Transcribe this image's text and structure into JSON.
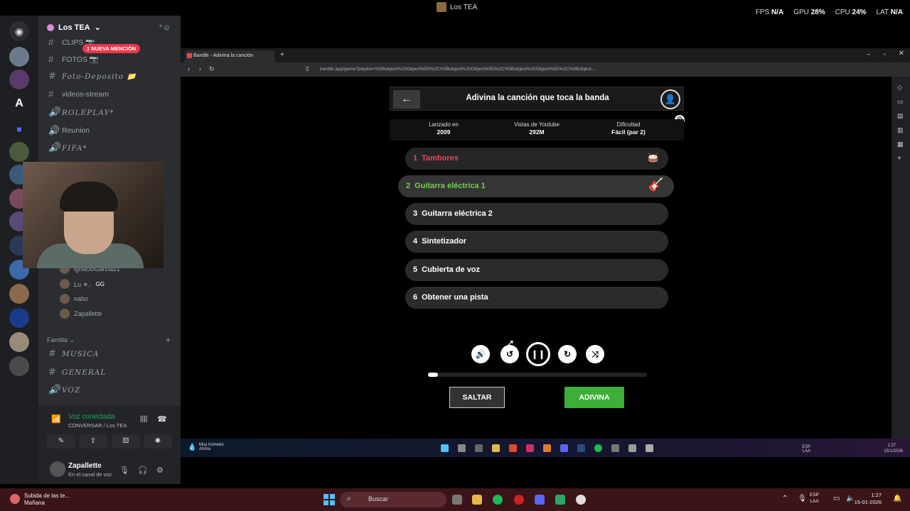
{
  "window": {
    "title": "Los TEA"
  },
  "stats": [
    {
      "label": "FPS",
      "value": "N/A"
    },
    {
      "label": "GPU",
      "value": "28%"
    },
    {
      "label": "CPU",
      "value": "24%"
    },
    {
      "label": "LAT",
      "value": "N/A"
    }
  ],
  "discord": {
    "server_name": "Los TEA",
    "mention_badge": "1 NUEVA MENCIÓN",
    "channels": [
      {
        "type": "text",
        "name": "CLIPS 📷"
      },
      {
        "type": "text",
        "name": "FOTOS 📷"
      },
      {
        "type": "text",
        "name": "Foto-Deposito 📁"
      },
      {
        "type": "text",
        "name": "videos-stream"
      },
      {
        "type": "voice",
        "name": "ROLEPLAY*"
      },
      {
        "type": "voice",
        "name": "Reunion"
      },
      {
        "type": "voice",
        "name": "FIFA*"
      }
    ],
    "voice_users": [
      {
        "name": "ignacioGarcia21"
      },
      {
        "name": "Lu ✶⸝",
        "tag": "GG"
      },
      {
        "name": "nabo"
      },
      {
        "name": "Zapallette"
      }
    ],
    "category": "Familia",
    "family_channels": [
      {
        "type": "text",
        "name": "MUSICA"
      },
      {
        "type": "text",
        "name": "GENERAL"
      },
      {
        "type": "voice",
        "name": "VOZ"
      }
    ],
    "voice_status": "Voz conectada",
    "voice_channel": "CONVERSAR / Los TEA",
    "user": {
      "name": "Zapallette",
      "status": "En el canal de voz"
    }
  },
  "browser": {
    "tab_title": "Bandle - Adivina la canción",
    "url": "bandle.app/game?playlist=%5Bobject%20Object%5D%2C%5Bobject%20Object%5D%2C%5Bobject%20Object%5D%2C%5Bobject..."
  },
  "game": {
    "title": "Adivina la canción que toca la banda",
    "info": [
      {
        "label": "Lanzado en",
        "value": "2009"
      },
      {
        "label": "Vistas de Youtube",
        "value": "292M"
      },
      {
        "label": "Dificultad",
        "value": "Fácil (par 2)"
      }
    ],
    "clues": [
      {
        "num": "1",
        "label": "Tambores",
        "state": "failed"
      },
      {
        "num": "2",
        "label": "Guitarra eléctrica 1",
        "state": "current"
      },
      {
        "num": "3",
        "label": "Guitarra eléctrica 2",
        "state": "locked"
      },
      {
        "num": "4",
        "label": "Sintetizador",
        "state": "locked"
      },
      {
        "num": "5",
        "label": "Cubierta de voz",
        "state": "locked"
      },
      {
        "num": "6",
        "label": "Obtener una pista",
        "state": "locked"
      }
    ],
    "progress": 0.045,
    "skip_label": "SALTAR",
    "guess_label": "ADIVINA"
  },
  "inner_taskbar": {
    "weather_title": "Muy húmedo",
    "weather_sub": "Ahora",
    "lang": "ESP LAA",
    "time": "1:27",
    "date": "15/1/2026"
  },
  "taskbar": {
    "notif_title": "Subida de las te...",
    "notif_sub": "Mañana",
    "search_placeholder": "Buscar",
    "lang": "ESP",
    "lang2": "LAA",
    "time": "1:27",
    "date": "15-01-2026"
  },
  "colors": {
    "green": "#3dae37",
    "red": "#e04a5a",
    "clue_green": "#6ad34a"
  }
}
